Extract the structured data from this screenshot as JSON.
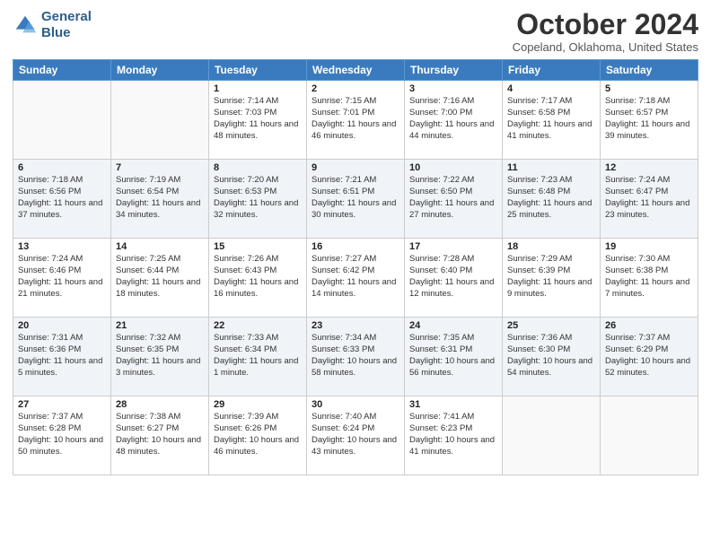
{
  "logo": {
    "line1": "General",
    "line2": "Blue"
  },
  "title": "October 2024",
  "subtitle": "Copeland, Oklahoma, United States",
  "headers": [
    "Sunday",
    "Monday",
    "Tuesday",
    "Wednesday",
    "Thursday",
    "Friday",
    "Saturday"
  ],
  "weeks": [
    [
      {
        "day": "",
        "info": ""
      },
      {
        "day": "",
        "info": ""
      },
      {
        "day": "1",
        "info": "Sunrise: 7:14 AM\nSunset: 7:03 PM\nDaylight: 11 hours and 48 minutes."
      },
      {
        "day": "2",
        "info": "Sunrise: 7:15 AM\nSunset: 7:01 PM\nDaylight: 11 hours and 46 minutes."
      },
      {
        "day": "3",
        "info": "Sunrise: 7:16 AM\nSunset: 7:00 PM\nDaylight: 11 hours and 44 minutes."
      },
      {
        "day": "4",
        "info": "Sunrise: 7:17 AM\nSunset: 6:58 PM\nDaylight: 11 hours and 41 minutes."
      },
      {
        "day": "5",
        "info": "Sunrise: 7:18 AM\nSunset: 6:57 PM\nDaylight: 11 hours and 39 minutes."
      }
    ],
    [
      {
        "day": "6",
        "info": "Sunrise: 7:18 AM\nSunset: 6:56 PM\nDaylight: 11 hours and 37 minutes."
      },
      {
        "day": "7",
        "info": "Sunrise: 7:19 AM\nSunset: 6:54 PM\nDaylight: 11 hours and 34 minutes."
      },
      {
        "day": "8",
        "info": "Sunrise: 7:20 AM\nSunset: 6:53 PM\nDaylight: 11 hours and 32 minutes."
      },
      {
        "day": "9",
        "info": "Sunrise: 7:21 AM\nSunset: 6:51 PM\nDaylight: 11 hours and 30 minutes."
      },
      {
        "day": "10",
        "info": "Sunrise: 7:22 AM\nSunset: 6:50 PM\nDaylight: 11 hours and 27 minutes."
      },
      {
        "day": "11",
        "info": "Sunrise: 7:23 AM\nSunset: 6:48 PM\nDaylight: 11 hours and 25 minutes."
      },
      {
        "day": "12",
        "info": "Sunrise: 7:24 AM\nSunset: 6:47 PM\nDaylight: 11 hours and 23 minutes."
      }
    ],
    [
      {
        "day": "13",
        "info": "Sunrise: 7:24 AM\nSunset: 6:46 PM\nDaylight: 11 hours and 21 minutes."
      },
      {
        "day": "14",
        "info": "Sunrise: 7:25 AM\nSunset: 6:44 PM\nDaylight: 11 hours and 18 minutes."
      },
      {
        "day": "15",
        "info": "Sunrise: 7:26 AM\nSunset: 6:43 PM\nDaylight: 11 hours and 16 minutes."
      },
      {
        "day": "16",
        "info": "Sunrise: 7:27 AM\nSunset: 6:42 PM\nDaylight: 11 hours and 14 minutes."
      },
      {
        "day": "17",
        "info": "Sunrise: 7:28 AM\nSunset: 6:40 PM\nDaylight: 11 hours and 12 minutes."
      },
      {
        "day": "18",
        "info": "Sunrise: 7:29 AM\nSunset: 6:39 PM\nDaylight: 11 hours and 9 minutes."
      },
      {
        "day": "19",
        "info": "Sunrise: 7:30 AM\nSunset: 6:38 PM\nDaylight: 11 hours and 7 minutes."
      }
    ],
    [
      {
        "day": "20",
        "info": "Sunrise: 7:31 AM\nSunset: 6:36 PM\nDaylight: 11 hours and 5 minutes."
      },
      {
        "day": "21",
        "info": "Sunrise: 7:32 AM\nSunset: 6:35 PM\nDaylight: 11 hours and 3 minutes."
      },
      {
        "day": "22",
        "info": "Sunrise: 7:33 AM\nSunset: 6:34 PM\nDaylight: 11 hours and 1 minute."
      },
      {
        "day": "23",
        "info": "Sunrise: 7:34 AM\nSunset: 6:33 PM\nDaylight: 10 hours and 58 minutes."
      },
      {
        "day": "24",
        "info": "Sunrise: 7:35 AM\nSunset: 6:31 PM\nDaylight: 10 hours and 56 minutes."
      },
      {
        "day": "25",
        "info": "Sunrise: 7:36 AM\nSunset: 6:30 PM\nDaylight: 10 hours and 54 minutes."
      },
      {
        "day": "26",
        "info": "Sunrise: 7:37 AM\nSunset: 6:29 PM\nDaylight: 10 hours and 52 minutes."
      }
    ],
    [
      {
        "day": "27",
        "info": "Sunrise: 7:37 AM\nSunset: 6:28 PM\nDaylight: 10 hours and 50 minutes."
      },
      {
        "day": "28",
        "info": "Sunrise: 7:38 AM\nSunset: 6:27 PM\nDaylight: 10 hours and 48 minutes."
      },
      {
        "day": "29",
        "info": "Sunrise: 7:39 AM\nSunset: 6:26 PM\nDaylight: 10 hours and 46 minutes."
      },
      {
        "day": "30",
        "info": "Sunrise: 7:40 AM\nSunset: 6:24 PM\nDaylight: 10 hours and 43 minutes."
      },
      {
        "day": "31",
        "info": "Sunrise: 7:41 AM\nSunset: 6:23 PM\nDaylight: 10 hours and 41 minutes."
      },
      {
        "day": "",
        "info": ""
      },
      {
        "day": "",
        "info": ""
      }
    ]
  ]
}
